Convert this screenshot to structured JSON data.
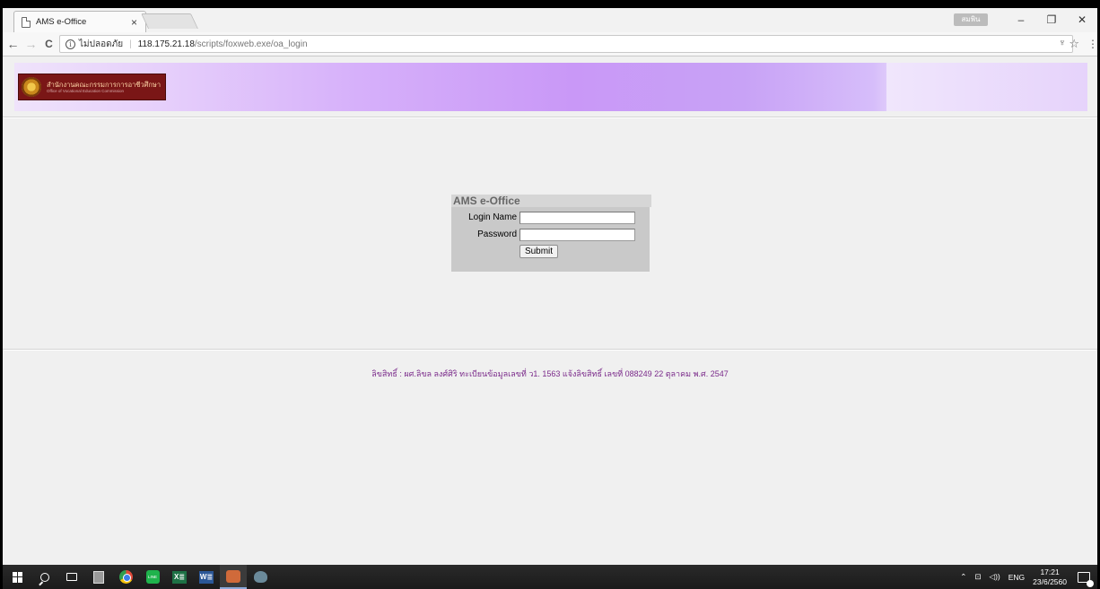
{
  "browser": {
    "tab": {
      "title": "AMS e-Office",
      "close_glyph": "×"
    },
    "window_controls": {
      "profile_label": "สมพิน",
      "minimize": "–",
      "restore": "❐",
      "close": "✕"
    },
    "nav": {
      "back": "←",
      "forward": "→",
      "reload": "C"
    },
    "address": {
      "secure_label": "ไม่ปลอดภัย",
      "separator": "|",
      "host": "118.175.21.18",
      "path": "/scripts/foxweb.exe/oa_login"
    },
    "icons": {
      "extension": "♆",
      "star": "☆",
      "menu": "⋮"
    }
  },
  "page": {
    "logo": {
      "thai": "สำนักงานคณะกรรมการการอาชีวศึกษา",
      "english": "Office of Vocational Education Commission"
    },
    "login": {
      "title": "AMS e-Office",
      "login_name_label": "Login Name",
      "login_name_value": "",
      "password_label": "Password",
      "password_value": "",
      "submit_label": "Submit"
    },
    "footer": "ลิขสิทธิ์ : ผศ.ลิขล ลงศ์ศิริ ทะเบียนข้อมูลเลขที่ ว1. 1563 แจ้งลิขสิทธิ์ เลขที่ 088249 22 ตุลาคม พ.ศ. 2547"
  },
  "taskbar": {
    "apps": [
      "start",
      "search",
      "task-view",
      "calculator",
      "chrome",
      "line",
      "excel",
      "word",
      "paint",
      "misc"
    ],
    "excel_label": "X≣",
    "word_label": "W≣",
    "line_label": "LINE",
    "tray": {
      "chevron": "⌃",
      "network": "⊡",
      "volume": "◁))",
      "language": "ENG",
      "time": "17:21",
      "date": "23/6/2560"
    }
  }
}
